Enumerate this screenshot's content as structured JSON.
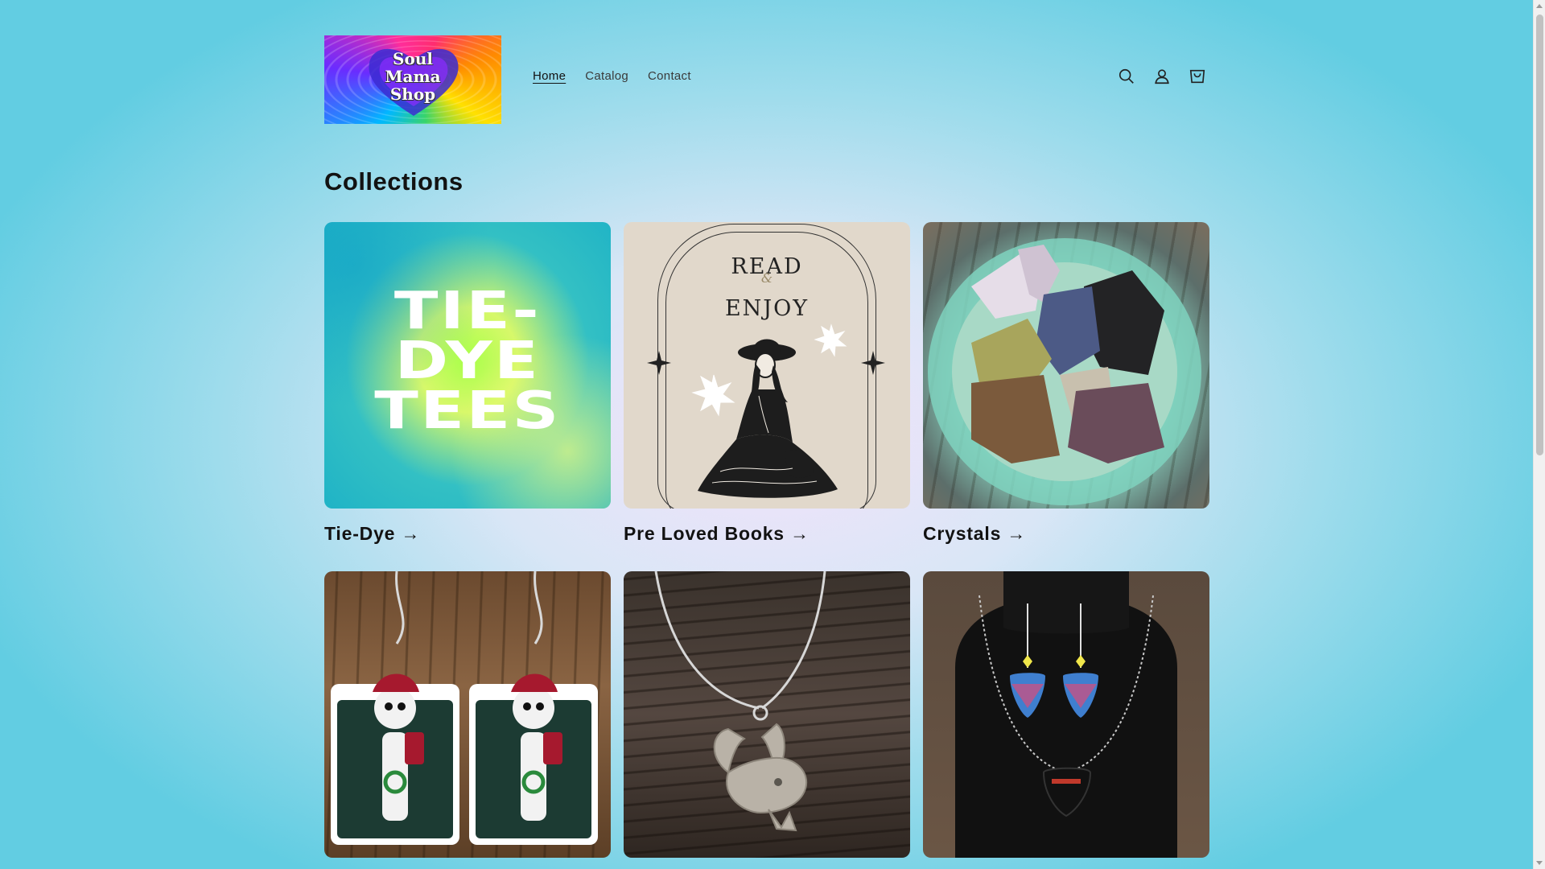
{
  "header": {
    "logo_text": "Soul\nMama\nShop",
    "nav": [
      {
        "label": "Home",
        "active": true
      },
      {
        "label": "Catalog",
        "active": false
      },
      {
        "label": "Contact",
        "active": false
      }
    ],
    "icons": [
      "search-icon",
      "account-icon",
      "cart-icon"
    ]
  },
  "main": {
    "heading": "Collections",
    "collections": [
      {
        "title": "Tie-Dye →",
        "image_text": "TIE-\nDYE\nTEES"
      },
      {
        "title": "Pre Loved Books →",
        "image_text": "READ\nENJOY",
        "image_amp": "&"
      },
      {
        "title": "Crystals →"
      },
      {
        "title": ""
      },
      {
        "title": ""
      },
      {
        "title": ""
      }
    ]
  },
  "colors": {
    "text": "#121212",
    "background_center": "#f3e3fb",
    "background_edge": "#62cde2"
  }
}
